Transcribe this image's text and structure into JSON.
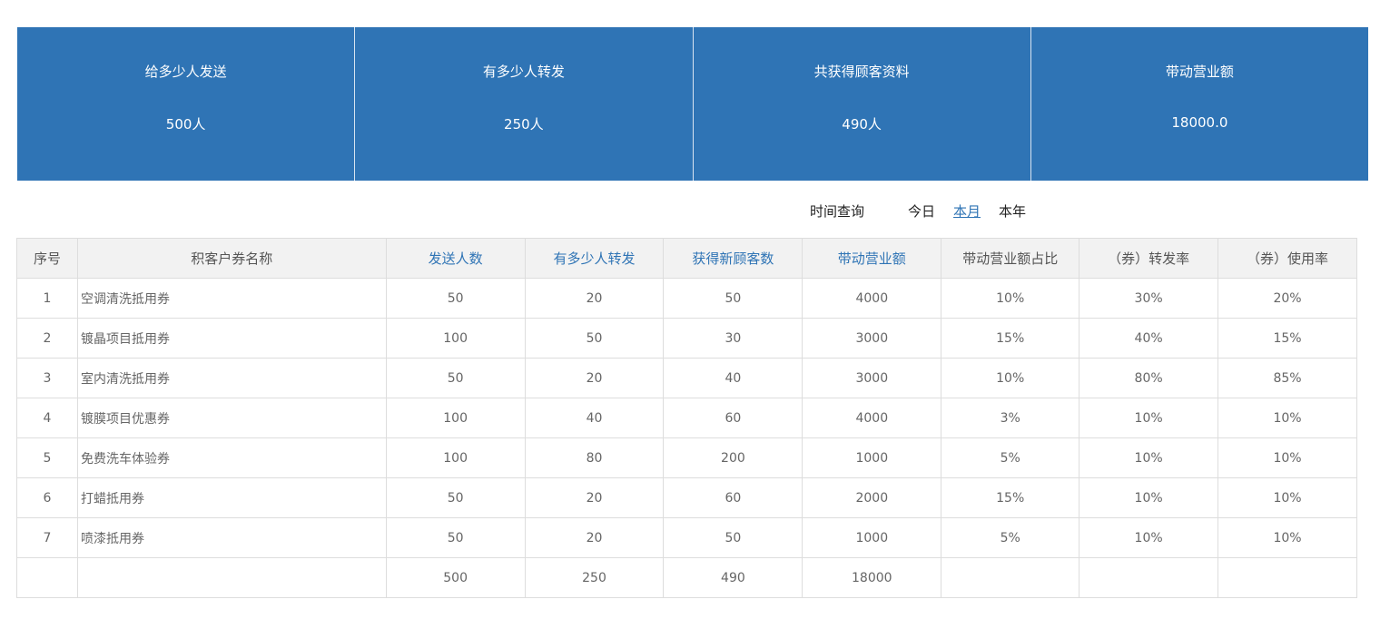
{
  "stats": [
    {
      "label": "给多少人发送",
      "value": "500人"
    },
    {
      "label": "有多少人转发",
      "value": "250人"
    },
    {
      "label": "共获得顾客资料",
      "value": "490人"
    },
    {
      "label": "带动营业额",
      "value": "18000.0"
    }
  ],
  "filter": {
    "label": "时间查询",
    "options": [
      "今日",
      "本月",
      "本年"
    ],
    "selected": "本月"
  },
  "table": {
    "headers": [
      "序号",
      "积客户券名称",
      "发送人数",
      "有多少人转发",
      "获得新顾客数",
      "带动营业额",
      "带动营业额占比",
      "（券）转发率",
      "（券）使用率"
    ],
    "rows": [
      [
        "1",
        "空调清洗抵用券",
        "50",
        "20",
        "50",
        "4000",
        "10%",
        "30%",
        "20%"
      ],
      [
        "2",
        "镀晶项目抵用券",
        "100",
        "50",
        "30",
        "3000",
        "15%",
        "40%",
        "15%"
      ],
      [
        "3",
        "室内清洗抵用券",
        "50",
        "20",
        "40",
        "3000",
        "10%",
        "80%",
        "85%"
      ],
      [
        "4",
        " 镀膜项目优惠券",
        "100",
        "40",
        "60",
        "4000",
        "3%",
        "10%",
        "10%"
      ],
      [
        "5",
        " 免费洗车体验券",
        "100",
        "80",
        "200",
        "1000",
        "5%",
        "10%",
        "10%"
      ],
      [
        "6",
        " 打蜡抵用券",
        "50",
        "20",
        "60",
        "2000",
        "15%",
        "10%",
        "10%"
      ],
      [
        "7",
        "喷漆抵用券",
        "50",
        "20",
        "50",
        "1000",
        "5%",
        "10%",
        "10%"
      ]
    ],
    "totals": [
      "",
      "",
      "500",
      "250",
      "490",
      "18000",
      "",
      "",
      ""
    ]
  },
  "colors": {
    "accent": "#2f74b5",
    "header_bg": "#f2f2f2",
    "border": "#dddddd"
  }
}
